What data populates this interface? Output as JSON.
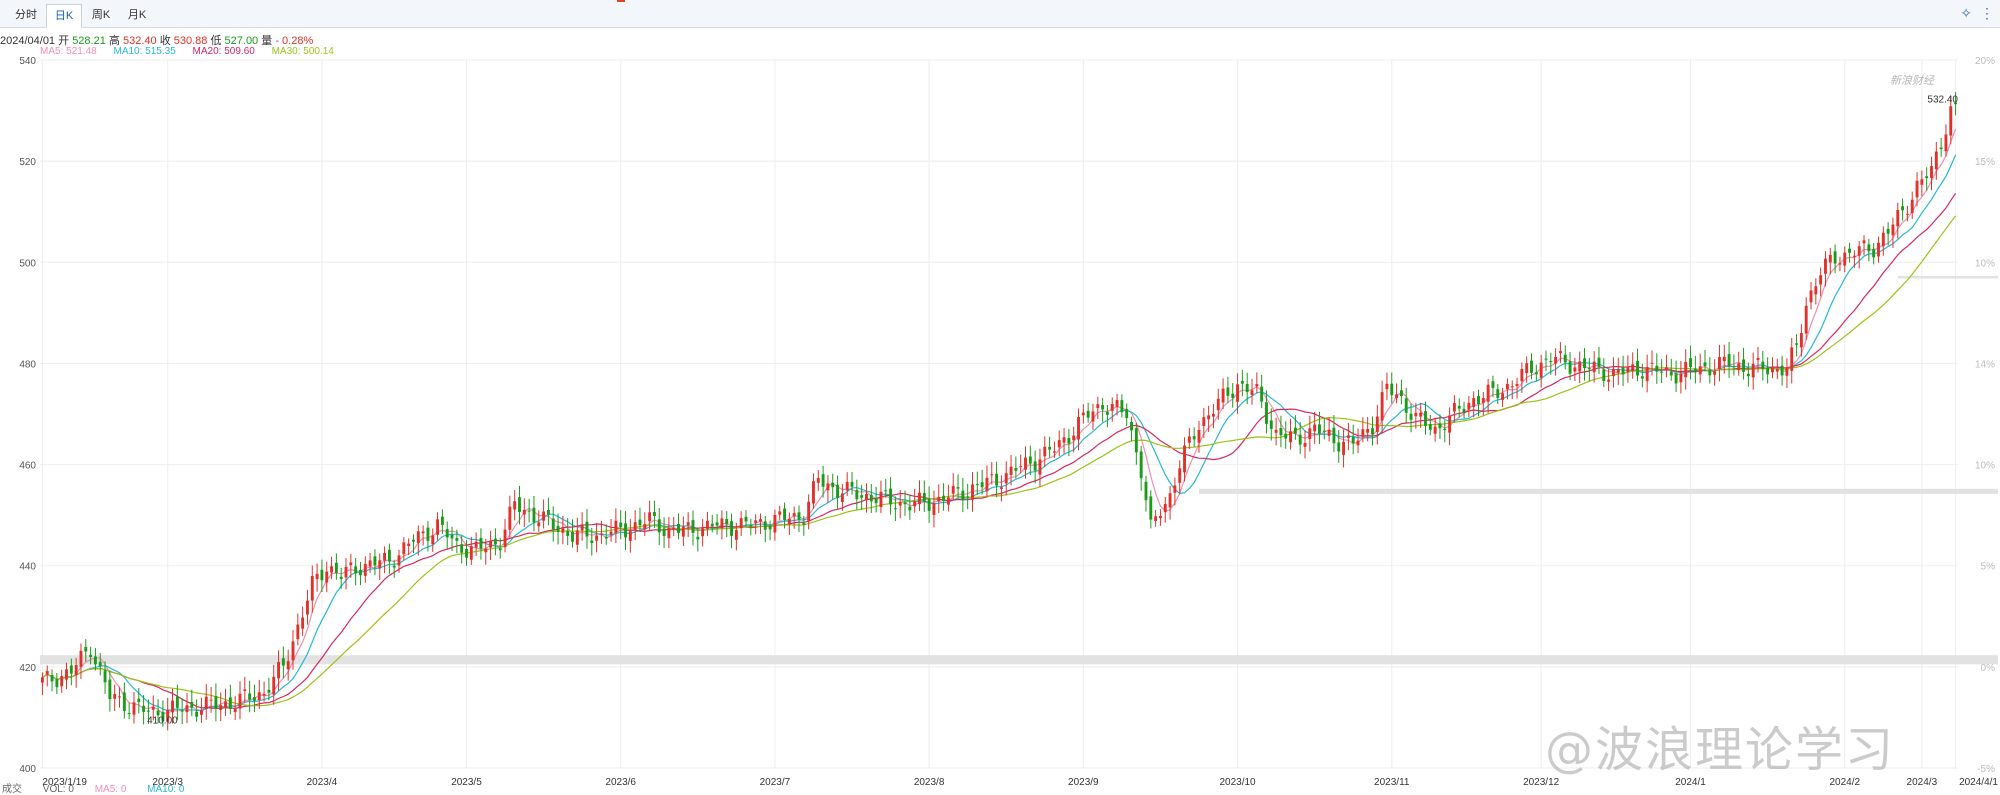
{
  "tabs": [
    {
      "label": "分时"
    },
    {
      "label": "日K"
    },
    {
      "label": "周K"
    },
    {
      "label": "月K"
    }
  ],
  "active_tab": 1,
  "info": {
    "date": "2024/04/01",
    "open_label": "开",
    "open": "528.21",
    "high_label": "高",
    "high": "532.40",
    "close_label": "收",
    "close": "530.88",
    "low_label": "低",
    "low": "527.00",
    "chg_label": "量",
    "chg": "- 0.28%"
  },
  "ma": {
    "ma5": "MA5: 521.48",
    "ma10": "MA10: 515.35",
    "ma20": "MA20: 509.60",
    "ma30": "MA30: 500.14"
  },
  "vol": {
    "label": "成交",
    "vol": "VOL: 0",
    "ma5": "MA5: 0",
    "ma10": "MA10: 0"
  },
  "colors": {
    "up": "#e0312b",
    "down": "#1a9c1a",
    "ma5": "#f08fb0",
    "ma10": "#25b8d8",
    "ma20": "#d8285e",
    "ma30": "#9cc21a",
    "grid": "#eeeeee",
    "band": "#e2e2e2"
  },
  "watermark": "@波浪理论学习",
  "corner_logo": "新浪财经",
  "chart_data": {
    "type": "candlestick",
    "y_ticks": [
      540,
      520,
      500,
      480,
      460,
      440,
      420,
      400
    ],
    "pct_ticks": [
      "20%",
      "15%",
      "10%",
      "14%",
      "10%",
      "5%",
      "0%",
      "-5%"
    ],
    "x_labels": [
      "2023/1/19",
      "2023/3",
      "2023/4",
      "2023/5",
      "2023/6",
      "2023/7",
      "2023/8",
      "2023/9",
      "2023/10",
      "2023/11",
      "2023/12",
      "2024/1",
      "2024/2",
      "2024/3",
      "2024/4/1"
    ],
    "ylim": [
      400,
      540
    ],
    "annotations": [
      {
        "text": "532.40",
        "value": 532.4
      },
      {
        "text": "410.00",
        "value": 410.0
      }
    ],
    "key_points": [
      [
        0,
        417
      ],
      [
        6,
        419
      ],
      [
        10,
        424
      ],
      [
        14,
        414
      ],
      [
        22,
        411
      ],
      [
        32,
        412
      ],
      [
        40,
        413
      ],
      [
        46,
        415
      ],
      [
        50,
        420
      ],
      [
        53,
        428
      ],
      [
        56,
        436
      ],
      [
        59,
        440
      ],
      [
        62,
        438
      ],
      [
        66,
        440
      ],
      [
        72,
        441
      ],
      [
        77,
        445
      ],
      [
        82,
        448
      ],
      [
        86,
        444
      ],
      [
        90,
        443
      ],
      [
        95,
        445
      ],
      [
        98,
        452
      ],
      [
        102,
        450
      ],
      [
        106,
        448
      ],
      [
        110,
        446
      ],
      [
        115,
        446
      ],
      [
        120,
        447
      ],
      [
        126,
        449
      ],
      [
        130,
        447
      ],
      [
        134,
        447
      ],
      [
        140,
        448
      ],
      [
        146,
        448
      ],
      [
        152,
        449
      ],
      [
        158,
        450
      ],
      [
        161,
        457
      ],
      [
        165,
        455
      ],
      [
        170,
        454
      ],
      [
        175,
        453
      ],
      [
        180,
        452
      ],
      [
        186,
        453
      ],
      [
        192,
        455
      ],
      [
        198,
        457
      ],
      [
        204,
        460
      ],
      [
        210,
        463
      ],
      [
        216,
        469
      ],
      [
        220,
        472
      ],
      [
        225,
        470
      ],
      [
        228,
        459
      ],
      [
        230,
        447
      ],
      [
        232,
        451
      ],
      [
        234,
        454
      ],
      [
        236,
        460
      ],
      [
        240,
        468
      ],
      [
        244,
        472
      ],
      [
        248,
        476
      ],
      [
        252,
        474
      ],
      [
        256,
        466
      ],
      [
        260,
        465
      ],
      [
        264,
        467
      ],
      [
        268,
        465
      ],
      [
        272,
        464
      ],
      [
        276,
        468
      ],
      [
        279,
        475
      ],
      [
        282,
        473
      ],
      [
        285,
        469
      ],
      [
        289,
        467
      ],
      [
        293,
        470
      ],
      [
        297,
        473
      ],
      [
        301,
        474
      ],
      [
        305,
        476
      ],
      [
        309,
        479
      ],
      [
        313,
        481
      ],
      [
        317,
        480
      ],
      [
        321,
        479
      ],
      [
        326,
        478
      ],
      [
        332,
        479
      ],
      [
        338,
        478
      ],
      [
        344,
        479
      ],
      [
        350,
        480
      ],
      [
        354,
        479
      ],
      [
        358,
        479
      ],
      [
        362,
        479
      ],
      [
        364,
        483
      ],
      [
        366,
        492
      ],
      [
        369,
        498
      ],
      [
        372,
        501
      ],
      [
        376,
        502
      ],
      [
        380,
        503
      ],
      [
        383,
        506
      ],
      [
        386,
        510
      ],
      [
        389,
        515
      ],
      [
        392,
        518
      ],
      [
        395,
        527
      ],
      [
        396,
        530
      ]
    ]
  }
}
